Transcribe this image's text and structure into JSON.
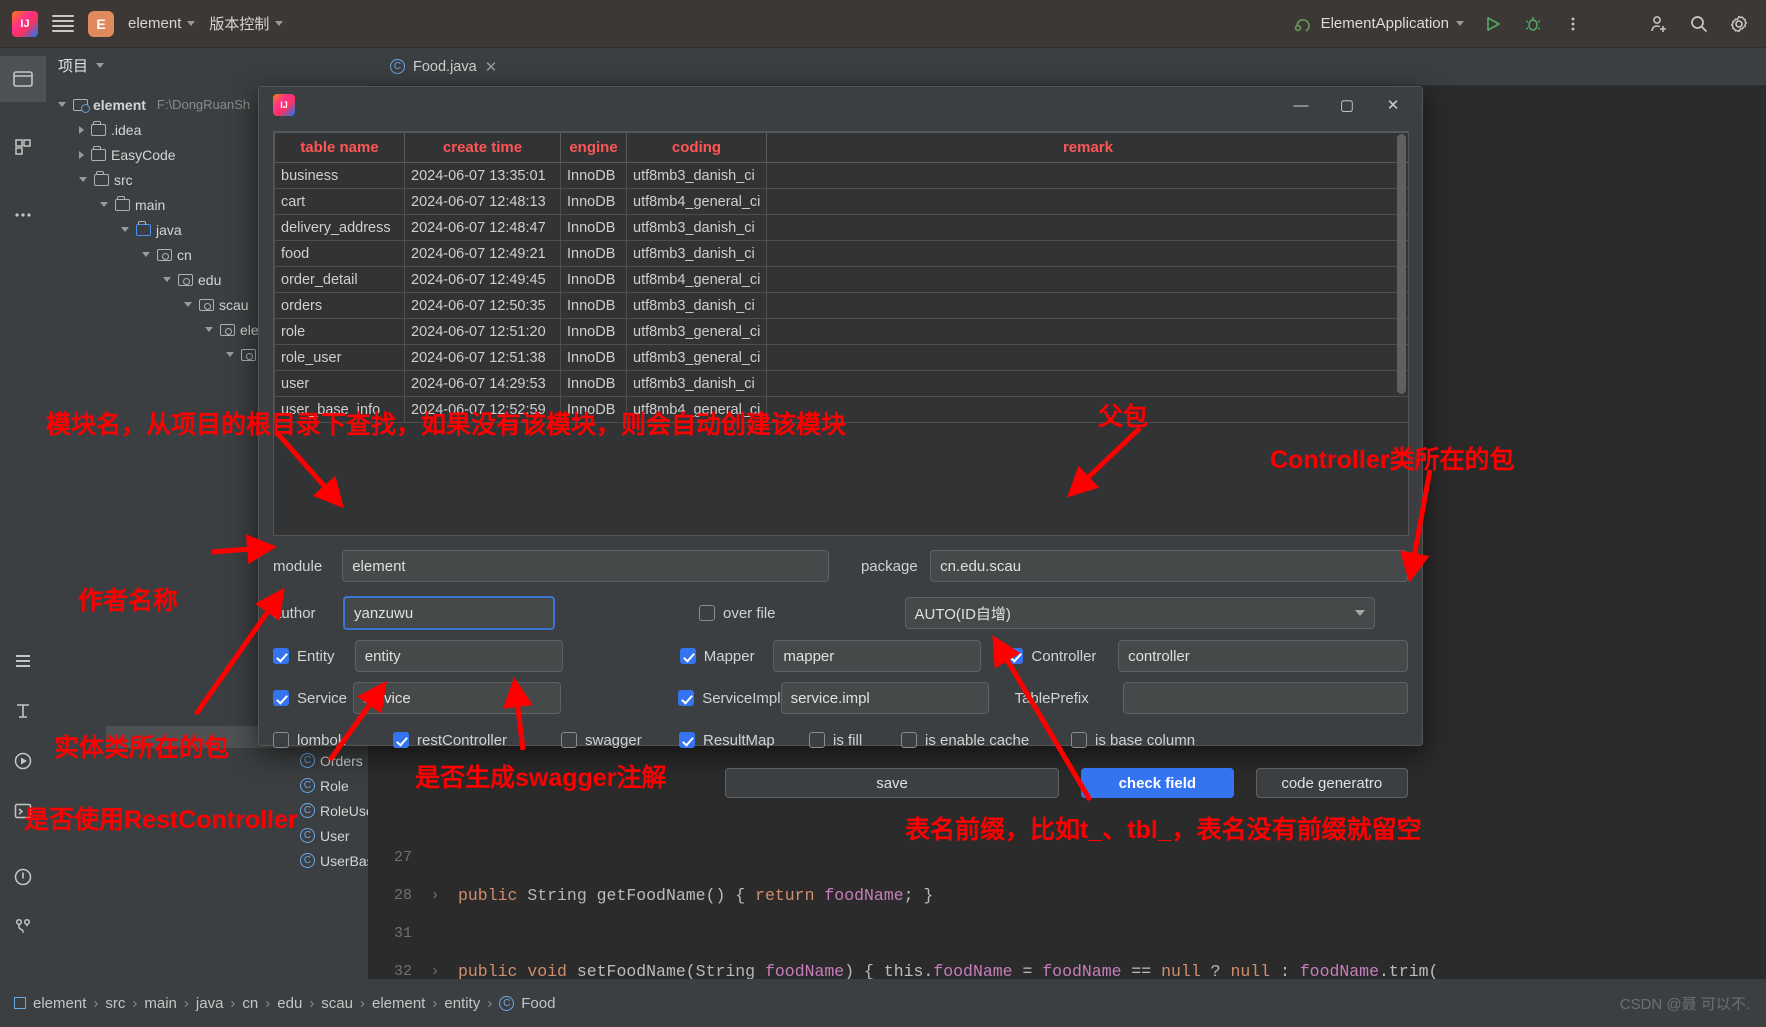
{
  "toolbar": {
    "project_badge": "E",
    "project_name": "element",
    "vcs_label": "版本控制",
    "run_config": "ElementApplication",
    "icons": [
      "run-icon",
      "debug-icon",
      "more-icon",
      "add-user-icon",
      "search-icon",
      "settings-icon"
    ]
  },
  "project_panel": {
    "title": "项目",
    "tree": [
      {
        "label": "element",
        "path": "F:\\DongRuanSh",
        "depth": 0,
        "arrow": "open",
        "icon": "module-icon",
        "bold": true
      },
      {
        "label": ".idea",
        "depth": 1,
        "arrow": "closed",
        "icon": "folder-icon"
      },
      {
        "label": "EasyCode",
        "depth": 1,
        "arrow": "closed",
        "icon": "folder-icon"
      },
      {
        "label": "src",
        "depth": 1,
        "arrow": "open",
        "icon": "folder-icon"
      },
      {
        "label": "main",
        "depth": 2,
        "arrow": "open",
        "icon": "folder-icon"
      },
      {
        "label": "java",
        "depth": 3,
        "arrow": "open",
        "icon": "folder-blue-icon"
      },
      {
        "label": "cn",
        "depth": 4,
        "arrow": "open",
        "icon": "package-icon"
      },
      {
        "label": "edu",
        "depth": 5,
        "arrow": "open",
        "icon": "package-icon"
      },
      {
        "label": "scau",
        "depth": 6,
        "arrow": "open",
        "icon": "package-icon"
      },
      {
        "label": "ele",
        "depth": 7,
        "arrow": "open",
        "icon": "package-icon"
      },
      {
        "label": "",
        "depth": 8,
        "arrow": "open",
        "icon": "package-icon"
      }
    ],
    "tree_lower": [
      {
        "label": "",
        "depth": 5,
        "arrow": "open",
        "icon": "package-icon"
      },
      {
        "label": "",
        "depth": 5,
        "arrow": "open",
        "icon": "package-icon"
      }
    ],
    "classes": [
      {
        "label": "Orders",
        "icon": "class-icon"
      },
      {
        "label": "Role",
        "icon": "class-icon"
      },
      {
        "label": "RoleUser",
        "icon": "class-icon"
      },
      {
        "label": "User",
        "icon": "class-icon"
      },
      {
        "label": "UserBaseInfo",
        "icon": "class-icon"
      }
    ]
  },
  "editor": {
    "tab": {
      "label": "Food.java",
      "icon": "java-class-icon",
      "close": "✕"
    },
    "lines": [
      {
        "num": "27",
        "chevron": "",
        "code": ""
      },
      {
        "num": "28",
        "chevron": "›",
        "code": "public String getFoodName() { return foodName; }"
      },
      {
        "num": "31",
        "chevron": "",
        "code": ""
      },
      {
        "num": "32",
        "chevron": "›",
        "code": "public void setFoodName(String foodName) { this.foodName = foodName == null ? null : foodName.trim("
      }
    ]
  },
  "dialog": {
    "window_controls": {
      "minimize": "—",
      "maximize": "▢",
      "close": "✕"
    },
    "table": {
      "headers": [
        "table name",
        "create time",
        "engine",
        "coding",
        "remark"
      ],
      "rows": [
        [
          "business",
          "2024-06-07 13:35:01",
          "InnoDB",
          "utf8mb3_danish_ci",
          ""
        ],
        [
          "cart",
          "2024-06-07 12:48:13",
          "InnoDB",
          "utf8mb4_general_ci",
          ""
        ],
        [
          "delivery_address",
          "2024-06-07 12:48:47",
          "InnoDB",
          "utf8mb3_danish_ci",
          ""
        ],
        [
          "food",
          "2024-06-07 12:49:21",
          "InnoDB",
          "utf8mb3_danish_ci",
          ""
        ],
        [
          "order_detail",
          "2024-06-07 12:49:45",
          "InnoDB",
          "utf8mb4_general_ci",
          ""
        ],
        [
          "orders",
          "2024-06-07 12:50:35",
          "InnoDB",
          "utf8mb3_danish_ci",
          ""
        ],
        [
          "role",
          "2024-06-07 12:51:20",
          "InnoDB",
          "utf8mb3_general_ci",
          ""
        ],
        [
          "role_user",
          "2024-06-07 12:51:38",
          "InnoDB",
          "utf8mb3_general_ci",
          ""
        ],
        [
          "user",
          "2024-06-07 14:29:53",
          "InnoDB",
          "utf8mb3_danish_ci",
          ""
        ],
        [
          "user_base_info",
          "2024-06-07 12:52:59",
          "InnoDB",
          "utf8mb4_general_ci",
          ""
        ]
      ]
    },
    "form": {
      "module_label": "module",
      "module_value": "element",
      "package_label": "package",
      "package_value": "cn.edu.scau",
      "author_label": "author",
      "author_value": "yanzuwu",
      "over_file_label": "over file",
      "over_file_checked": false,
      "id_strategy_value": "AUTO(ID自增)",
      "entity_label": "Entity",
      "entity_checked": true,
      "entity_value": "entity",
      "mapper_label": "Mapper",
      "mapper_checked": true,
      "mapper_value": "mapper",
      "controller_label": "Controller",
      "controller_checked": true,
      "controller_value": "controller",
      "service_label": "Service",
      "service_checked": true,
      "service_value": "service",
      "serviceimpl_label": "ServiceImpl",
      "serviceimpl_checked": true,
      "serviceimpl_value": "service.impl",
      "tableprefix_label": "TablePrefix",
      "tableprefix_value": "",
      "flags": [
        {
          "label": "lombok",
          "checked": false
        },
        {
          "label": "restController",
          "checked": true
        },
        {
          "label": "swagger",
          "checked": false
        },
        {
          "label": "ResultMap",
          "checked": true
        },
        {
          "label": "is fill",
          "checked": false
        },
        {
          "label": "is enable cache",
          "checked": false
        },
        {
          "label": "is base column",
          "checked": false
        }
      ],
      "save_label": "save",
      "check_field_label": "check field",
      "code_generator_label": "code generatro"
    }
  },
  "annotations": [
    {
      "id": "module-note",
      "text": "模块名，从项目的根目录下查找，如果没有该模块，则会自动创建该模块"
    },
    {
      "id": "parent-package-note",
      "text": "父包"
    },
    {
      "id": "controller-package-note",
      "text": "Controller类所在的包"
    },
    {
      "id": "author-note",
      "text": "作者名称"
    },
    {
      "id": "entity-package-note",
      "text": "实体类所在的包"
    },
    {
      "id": "restcontroller-note",
      "text": "是否使用RestController"
    },
    {
      "id": "swagger-note",
      "text": "是否生成swagger注解"
    },
    {
      "id": "tableprefix-note",
      "text": "表名前缀，比如t_、tbl_，表名没有前缀就留空"
    }
  ],
  "statusbar": {
    "breadcrumb": [
      "element",
      "src",
      "main",
      "java",
      "cn",
      "edu",
      "scau",
      "element",
      "entity",
      "Food"
    ],
    "separator": "›",
    "watermark": "CSDN @聂 可以不."
  },
  "colors": {
    "accent_blue": "#3574f0",
    "annotation_red": "#ff0000",
    "header_red": "#ff5555",
    "panel_bg": "#3c3f41",
    "editor_bg": "#2b2b2b"
  }
}
